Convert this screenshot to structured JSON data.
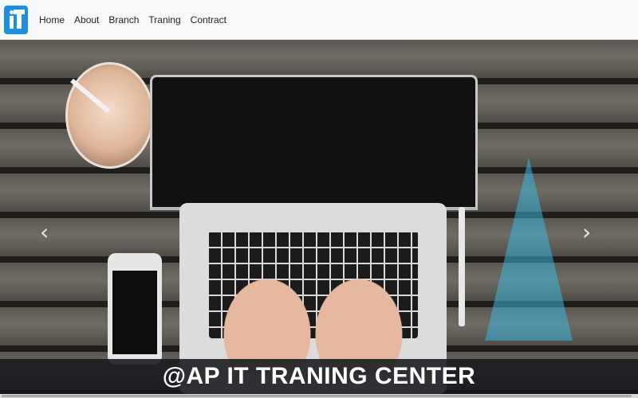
{
  "header": {
    "logo_icon": "it-logo-icon",
    "brand_color": "#1d8fe0",
    "nav": [
      {
        "label": "Home"
      },
      {
        "label": "About"
      },
      {
        "label": "Branch"
      },
      {
        "label": "Traning"
      },
      {
        "label": "Contract"
      }
    ]
  },
  "carousel": {
    "prev_icon": "chevron-left-icon",
    "next_icon": "chevron-right-icon",
    "prev_glyph": "‹",
    "next_glyph": "›",
    "caption": "@AP IT TRANING CENTER"
  }
}
